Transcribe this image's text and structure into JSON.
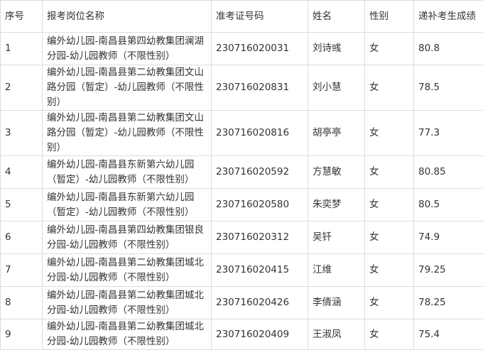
{
  "headers": {
    "index": "序号",
    "position": "报考岗位名称",
    "exam_no": "准考证号码",
    "name": "姓名",
    "gender": "性别",
    "score": "递补考生成绩"
  },
  "rows": [
    {
      "index": "1",
      "position": "编外幼儿园-南昌县第四幼教集团澜湖分园-幼儿园教师（不限性别）",
      "exam_no": "230716020031",
      "name": "刘诗彧",
      "gender": "女",
      "score": "80.8"
    },
    {
      "index": "2",
      "position": "编外幼儿园-南昌县第二幼教集团文山路分园（暂定）-幼儿园教师（不限性别）",
      "exam_no": "230716020831",
      "name": "刘小慧",
      "gender": "女",
      "score": "78.5"
    },
    {
      "index": "3",
      "position": "编外幼儿园-南昌县第二幼教集团文山路分园（暂定）-幼儿园教师（不限性别）",
      "exam_no": "230716020816",
      "name": "胡亭亭",
      "gender": "女",
      "score": "77.3"
    },
    {
      "index": "4",
      "position": "编外幼儿园-南昌县东新第六幼儿园（暂定）-幼儿园教师（不限性别）",
      "exam_no": "230716020592",
      "name": "方慧敏",
      "gender": "女",
      "score": "80.85"
    },
    {
      "index": "5",
      "position": "编外幼儿园-南昌县东新第六幼儿园（暂定）-幼儿园教师（不限性别）",
      "exam_no": "230716020580",
      "name": "朱奕梦",
      "gender": "女",
      "score": "80.5"
    },
    {
      "index": "6",
      "position": "编外幼儿园-南昌县第四幼教集团银良分园-幼儿园教师（不限性别）",
      "exam_no": "230716020312",
      "name": "吴钎",
      "gender": "女",
      "score": "74.9"
    },
    {
      "index": "7",
      "position": "编外幼儿园-南昌县第二幼教集团城北分园-幼儿园教师（不限性别）",
      "exam_no": "230716020415",
      "name": "江维",
      "gender": "女",
      "score": "79.25"
    },
    {
      "index": "8",
      "position": "编外幼儿园-南昌县第二幼教集团城北分园-幼儿园教师（不限性别）",
      "exam_no": "230716020426",
      "name": "李倩涵",
      "gender": "女",
      "score": "78.25"
    },
    {
      "index": "9",
      "position": "编外幼儿园-南昌县第二幼教集团城北分园-幼儿园教师（不限性别）",
      "exam_no": "230716020409",
      "name": "王淑凤",
      "gender": "女",
      "score": "75.4"
    }
  ]
}
